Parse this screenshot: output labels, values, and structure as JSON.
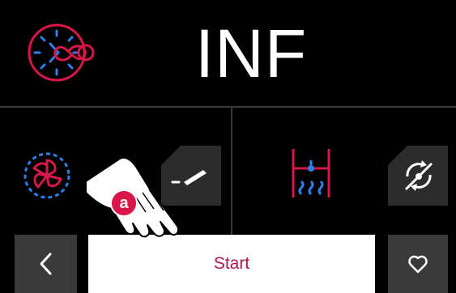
{
  "header": {
    "title": "INF",
    "program_icon": "clock-infinity-icon"
  },
  "function_row": {
    "fan_icon": "fan-icon",
    "edit_icon": "edit-pencil-icon",
    "steam_icon": "steam-water-level-icon",
    "rotate_icon": "rotate-icon"
  },
  "bottom_bar": {
    "back_icon": "chevron-left-icon",
    "start_label": "Start",
    "favorite_icon": "heart-icon"
  },
  "annotation": {
    "marker_label": "a",
    "hand_icon": "pointing-hand-icon"
  },
  "colors": {
    "accent_red": "#d8164a",
    "accent_blue": "#2d7ff0",
    "background": "#000000",
    "panel": "#3a3a3a",
    "start_text": "#b0184a"
  }
}
